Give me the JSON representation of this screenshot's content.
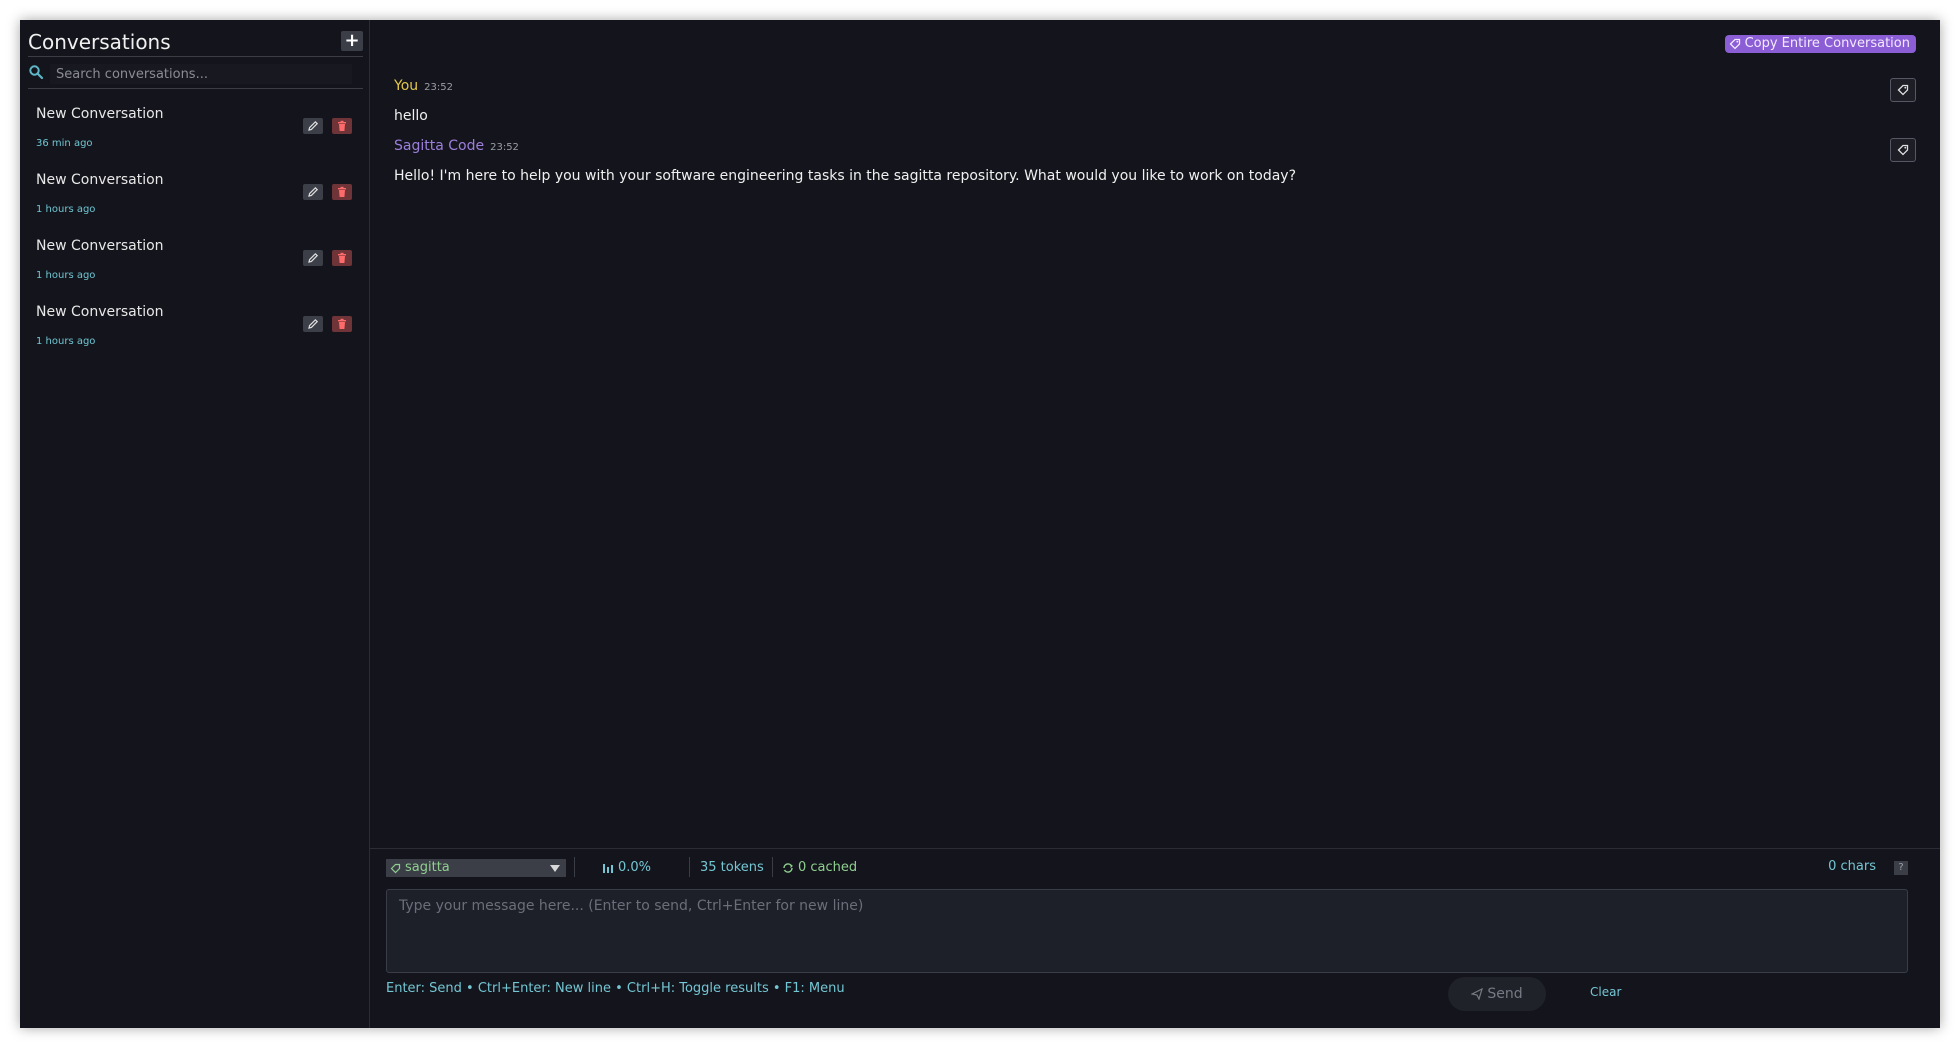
{
  "sidebar": {
    "title": "Conversations",
    "new_button_label": "+",
    "search_placeholder": "Search conversations...",
    "conversations": [
      {
        "title": "New Conversation",
        "time": "36 min ago"
      },
      {
        "title": "New Conversation",
        "time": "1 hours ago"
      },
      {
        "title": "New Conversation",
        "time": "1 hours ago"
      },
      {
        "title": "New Conversation",
        "time": "1 hours ago"
      }
    ]
  },
  "main": {
    "copy_all_label": "Copy Entire Conversation",
    "messages": [
      {
        "author": "You",
        "time": "23:52",
        "text": "hello"
      },
      {
        "author": "Sagitta Code",
        "time": "23:52",
        "text": "Hello! I'm here to help you with your software engineering tasks in the sagitta repository. What would you like to work on today?"
      }
    ]
  },
  "input_panel": {
    "repo": "sagitta",
    "usage_percent": "0.0%",
    "tokens": "35 tokens",
    "cached": "0 cached",
    "chars": "0 chars",
    "help_label": "?",
    "placeholder": "Type your message here... (Enter to send, Ctrl+Enter for new line)",
    "shortcuts": "Enter: Send • Ctrl+Enter: New line • Ctrl+H: Toggle results • F1: Menu",
    "send_label": "Send",
    "clear_label": "Clear"
  },
  "colors": {
    "background": "#14151c",
    "accent_purple": "#8b5ed6",
    "user_name": "#e3c84a",
    "assistant_name": "#9c7fdc",
    "info_cyan": "#74c6d4",
    "success_green": "#8fd08f"
  }
}
